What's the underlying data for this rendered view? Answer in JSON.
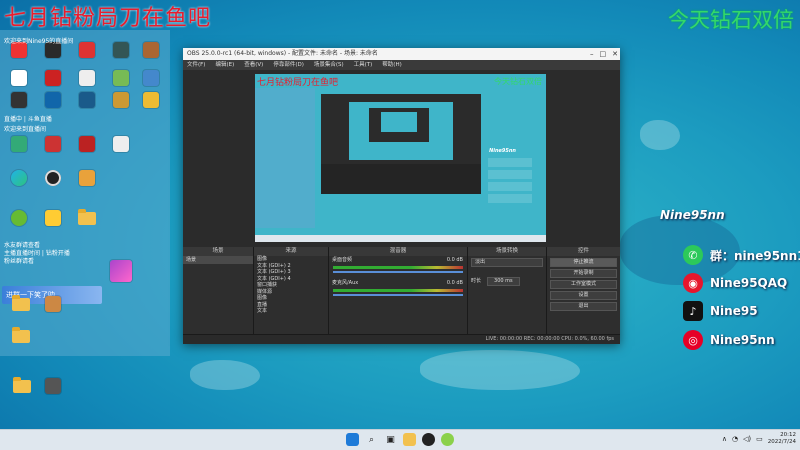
{
  "overlay": {
    "title": "七月钻粉局刀在鱼吧",
    "promo": "今天钻石双倍"
  },
  "desktop": {
    "notes": [
      "欢迎来到Nine95的直播间",
      "直播中 | 斗鱼直播",
      "欢迎来到直播间",
      "水友群请查看",
      "主播直播时间 | 钻粉开播",
      "粉丝群请看"
    ],
    "banner": "进群一下笑了叻"
  },
  "obs": {
    "title": "OBS 25.0.0-rc1 (64-bit, windows) - 配置文件: 未命名 - 场景: 未命名",
    "menu": [
      "文件(F)",
      "编辑(E)",
      "查看(V)",
      "停靠部件(D)",
      "场景集合(S)",
      "工具(T)",
      "帮助(H)"
    ],
    "docks": {
      "scenes": {
        "title": "场景",
        "items": [
          "场景"
        ]
      },
      "sources": {
        "title": "来源",
        "items": [
          "图像",
          "文本 (GDI+) 2",
          "文本 (GDI+) 3",
          "文本 (GDI+) 4",
          "窗口捕获",
          "媒体源",
          "图像",
          "直播",
          "文本"
        ]
      },
      "mixer": {
        "title": "混音器",
        "channels": [
          {
            "name": "桌面音频",
            "db": "0.0 dB"
          },
          {
            "name": "麦克风/Aux",
            "db": "0.0 dB"
          }
        ]
      },
      "transitions": {
        "title": "场景转换",
        "type": "淡出",
        "duration_label": "时长",
        "duration": "300 ms"
      },
      "controls": {
        "title": "控件",
        "buttons": [
          "停止推流",
          "开始录制",
          "工作室模式",
          "设置",
          "退出"
        ]
      }
    },
    "status": "LIVE: 00:00:00   REC: 00:00:00   CPU: 0.0%, 60.00 fps"
  },
  "social": {
    "name": "Nine95nn",
    "items": [
      {
        "icon": "wechat-icon",
        "label": "群：nine95nn1",
        "color": "#2cc95a"
      },
      {
        "icon": "weibo-icon",
        "label": "Nine95QAQ",
        "color": "#e6162d"
      },
      {
        "icon": "douyin-icon",
        "label": "Nine95",
        "color": "#111111"
      },
      {
        "icon": "netease-music-icon",
        "label": "Nine95nn",
        "color": "#e60026"
      }
    ]
  },
  "taskbar": {
    "time": "20:12",
    "date": "2022/7/24"
  }
}
